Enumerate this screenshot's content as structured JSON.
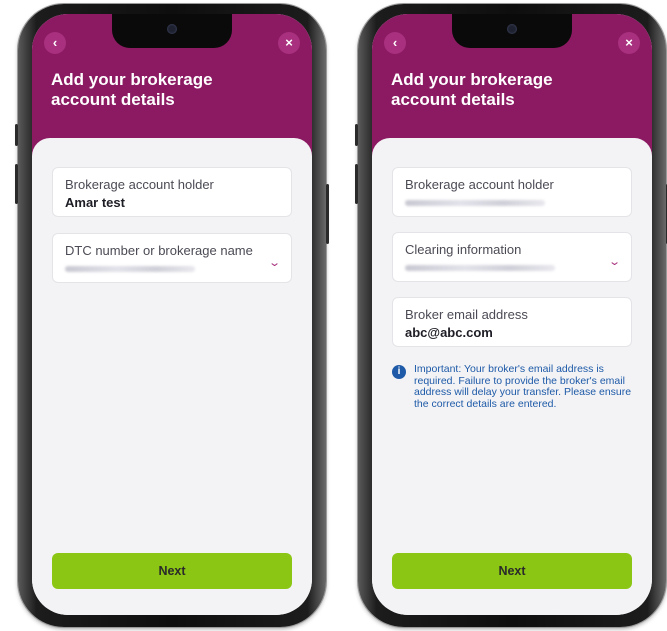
{
  "left_screen": {
    "back_icon": "chevron-left-icon",
    "close_icon": "close-icon",
    "title": "Add your brokerage account details",
    "fields": [
      {
        "label": "Brokerage account holder",
        "value": "Amar test"
      },
      {
        "label": "DTC number or brokerage name",
        "value": ""
      }
    ],
    "next_label": "Next"
  },
  "right_screen": {
    "back_icon": "chevron-left-icon",
    "close_icon": "close-icon",
    "title": "Add your brokerage account details",
    "fields": [
      {
        "label": "Brokerage account holder",
        "value": ""
      },
      {
        "label": "Clearing information",
        "value": ""
      },
      {
        "label": "Broker email address",
        "value": "abc@abc.com"
      }
    ],
    "info_text": "Important: Your broker's email address is required. Failure to provide the broker's email address will delay your transfer. Please ensure the correct details are entered.",
    "next_label": "Next"
  },
  "colors": {
    "header": "#8b1a62",
    "accent": "#a8307e",
    "next_button": "#8cc614",
    "info": "#1e5aa8"
  }
}
